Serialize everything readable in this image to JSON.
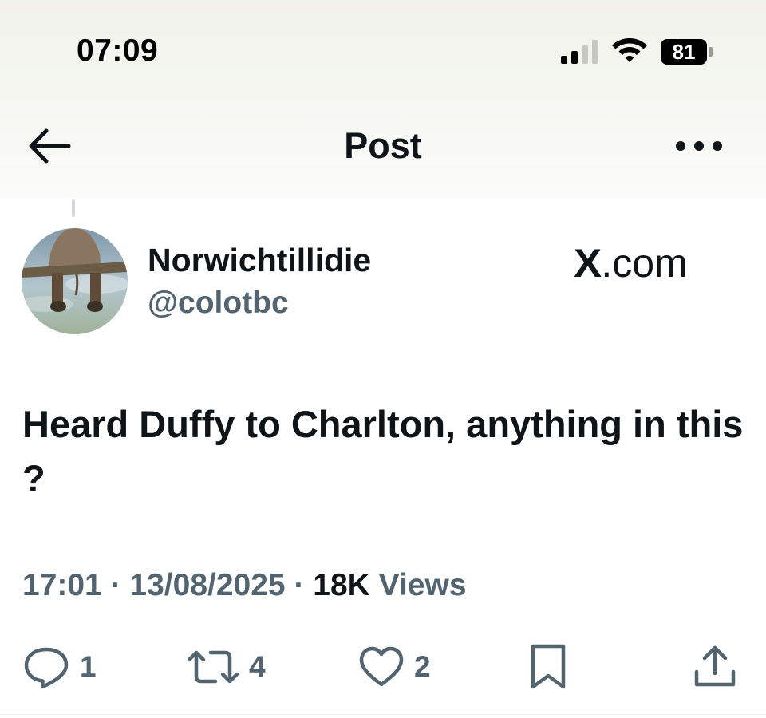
{
  "status_bar": {
    "time": "07:09",
    "battery_level": "81",
    "signal_bars_active": 2,
    "signal_bars_total": 4
  },
  "nav": {
    "title": "Post",
    "back_icon": "arrow-left-icon",
    "more_icon": "more-horizontal-icon"
  },
  "author": {
    "display_name": "Norwichtillidie",
    "handle": "@colotbc"
  },
  "watermark": {
    "x_letter": "X",
    "domain_suffix": ".com"
  },
  "post": {
    "text": "Heard Duffy to Charlton, anything in this ?"
  },
  "meta": {
    "time": "17:01",
    "separator": " · ",
    "date": "13/08/2025",
    "views_count": "18K",
    "views_label": " Views"
  },
  "actions": {
    "replies": "1",
    "reposts": "4",
    "likes": "2"
  },
  "colors": {
    "text_primary": "#0f1419",
    "text_secondary": "#536471"
  }
}
